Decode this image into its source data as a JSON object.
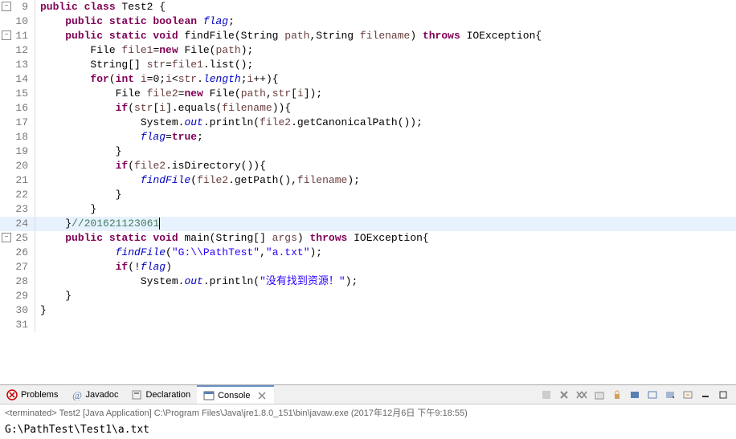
{
  "chart_data": null,
  "editor": {
    "lines": [
      {
        "num": 9,
        "marker": "minus",
        "tokens": [
          {
            "t": "public ",
            "c": "kw"
          },
          {
            "t": "class ",
            "c": "kw"
          },
          {
            "t": "Test2 {",
            "c": ""
          }
        ]
      },
      {
        "num": 10,
        "tokens": [
          {
            "t": "    ",
            "c": ""
          },
          {
            "t": "public static boolean ",
            "c": "kw"
          },
          {
            "t": "flag",
            "c": "static-it"
          },
          {
            "t": ";",
            "c": ""
          }
        ]
      },
      {
        "num": 11,
        "marker": "minus",
        "tokens": [
          {
            "t": "    ",
            "c": ""
          },
          {
            "t": "public static void ",
            "c": "kw"
          },
          {
            "t": "findFile(String ",
            "c": ""
          },
          {
            "t": "path",
            "c": "arg-it"
          },
          {
            "t": ",String ",
            "c": ""
          },
          {
            "t": "filename",
            "c": "arg-it"
          },
          {
            "t": ") ",
            "c": ""
          },
          {
            "t": "throws ",
            "c": "kw"
          },
          {
            "t": "IOException{",
            "c": ""
          }
        ]
      },
      {
        "num": 12,
        "tokens": [
          {
            "t": "        File ",
            "c": ""
          },
          {
            "t": "file1",
            "c": "arg-it"
          },
          {
            "t": "=",
            "c": ""
          },
          {
            "t": "new ",
            "c": "kw"
          },
          {
            "t": "File(",
            "c": ""
          },
          {
            "t": "path",
            "c": "arg-it"
          },
          {
            "t": ");",
            "c": ""
          }
        ]
      },
      {
        "num": 13,
        "tokens": [
          {
            "t": "        String[] ",
            "c": ""
          },
          {
            "t": "str",
            "c": "arg-it"
          },
          {
            "t": "=",
            "c": ""
          },
          {
            "t": "file1",
            "c": "arg-it"
          },
          {
            "t": ".list();",
            "c": ""
          }
        ]
      },
      {
        "num": 14,
        "tokens": [
          {
            "t": "        ",
            "c": ""
          },
          {
            "t": "for",
            "c": "kw"
          },
          {
            "t": "(",
            "c": ""
          },
          {
            "t": "int ",
            "c": "kw"
          },
          {
            "t": "i",
            "c": "arg-it"
          },
          {
            "t": "=0;",
            "c": ""
          },
          {
            "t": "i",
            "c": "arg-it"
          },
          {
            "t": "<",
            "c": ""
          },
          {
            "t": "str",
            "c": "arg-it"
          },
          {
            "t": ".",
            "c": ""
          },
          {
            "t": "length",
            "c": "static-it"
          },
          {
            "t": ";",
            "c": ""
          },
          {
            "t": "i",
            "c": "arg-it"
          },
          {
            "t": "++){",
            "c": ""
          }
        ]
      },
      {
        "num": 15,
        "tokens": [
          {
            "t": "            File ",
            "c": ""
          },
          {
            "t": "file2",
            "c": "arg-it"
          },
          {
            "t": "=",
            "c": ""
          },
          {
            "t": "new ",
            "c": "kw"
          },
          {
            "t": "File(",
            "c": ""
          },
          {
            "t": "path",
            "c": "arg-it"
          },
          {
            "t": ",",
            "c": ""
          },
          {
            "t": "str",
            "c": "arg-it"
          },
          {
            "t": "[",
            "c": ""
          },
          {
            "t": "i",
            "c": "arg-it"
          },
          {
            "t": "]);",
            "c": ""
          }
        ]
      },
      {
        "num": 16,
        "tokens": [
          {
            "t": "            ",
            "c": ""
          },
          {
            "t": "if",
            "c": "kw"
          },
          {
            "t": "(",
            "c": ""
          },
          {
            "t": "str",
            "c": "arg-it"
          },
          {
            "t": "[",
            "c": ""
          },
          {
            "t": "i",
            "c": "arg-it"
          },
          {
            "t": "].equals(",
            "c": ""
          },
          {
            "t": "filename",
            "c": "arg-it"
          },
          {
            "t": ")){",
            "c": ""
          }
        ]
      },
      {
        "num": 17,
        "tokens": [
          {
            "t": "                System.",
            "c": ""
          },
          {
            "t": "out",
            "c": "static-it"
          },
          {
            "t": ".println(",
            "c": ""
          },
          {
            "t": "file2",
            "c": "arg-it"
          },
          {
            "t": ".getCanonicalPath());",
            "c": ""
          }
        ]
      },
      {
        "num": 18,
        "tokens": [
          {
            "t": "                ",
            "c": ""
          },
          {
            "t": "flag",
            "c": "static-it"
          },
          {
            "t": "=",
            "c": ""
          },
          {
            "t": "true",
            "c": "kw"
          },
          {
            "t": ";",
            "c": ""
          }
        ]
      },
      {
        "num": 19,
        "tokens": [
          {
            "t": "            }",
            "c": ""
          }
        ]
      },
      {
        "num": 20,
        "tokens": [
          {
            "t": "            ",
            "c": ""
          },
          {
            "t": "if",
            "c": "kw"
          },
          {
            "t": "(",
            "c": ""
          },
          {
            "t": "file2",
            "c": "arg-it"
          },
          {
            "t": ".isDirectory()){",
            "c": ""
          }
        ]
      },
      {
        "num": 21,
        "tokens": [
          {
            "t": "                ",
            "c": ""
          },
          {
            "t": "findFile",
            "c": "static-it"
          },
          {
            "t": "(",
            "c": ""
          },
          {
            "t": "file2",
            "c": "arg-it"
          },
          {
            "t": ".getPath(),",
            "c": ""
          },
          {
            "t": "filename",
            "c": "arg-it"
          },
          {
            "t": ");",
            "c": ""
          }
        ]
      },
      {
        "num": 22,
        "tokens": [
          {
            "t": "            }",
            "c": ""
          }
        ]
      },
      {
        "num": 23,
        "tokens": [
          {
            "t": "        }",
            "c": ""
          }
        ]
      },
      {
        "num": 24,
        "highlight": true,
        "cursor": true,
        "tokens": [
          {
            "t": "    }",
            "c": ""
          },
          {
            "t": "//201621123061",
            "c": "cmt"
          }
        ]
      },
      {
        "num": 25,
        "marker": "minus",
        "tokens": [
          {
            "t": "    ",
            "c": ""
          },
          {
            "t": "public static void ",
            "c": "kw"
          },
          {
            "t": "main(String[] ",
            "c": ""
          },
          {
            "t": "args",
            "c": "arg-it"
          },
          {
            "t": ") ",
            "c": ""
          },
          {
            "t": "throws ",
            "c": "kw"
          },
          {
            "t": "IOException{",
            "c": ""
          }
        ]
      },
      {
        "num": 26,
        "tokens": [
          {
            "t": "            ",
            "c": ""
          },
          {
            "t": "findFile",
            "c": "static-it"
          },
          {
            "t": "(",
            "c": ""
          },
          {
            "t": "\"G:\\\\PathTest\"",
            "c": "str"
          },
          {
            "t": ",",
            "c": ""
          },
          {
            "t": "\"a.txt\"",
            "c": "str"
          },
          {
            "t": ");",
            "c": ""
          }
        ]
      },
      {
        "num": 27,
        "tokens": [
          {
            "t": "            ",
            "c": ""
          },
          {
            "t": "if",
            "c": "kw"
          },
          {
            "t": "(!",
            "c": ""
          },
          {
            "t": "flag",
            "c": "static-it"
          },
          {
            "t": ")",
            "c": ""
          }
        ]
      },
      {
        "num": 28,
        "tokens": [
          {
            "t": "                System.",
            "c": ""
          },
          {
            "t": "out",
            "c": "static-it"
          },
          {
            "t": ".println(",
            "c": ""
          },
          {
            "t": "\"没有找到资源！\"",
            "c": "str"
          },
          {
            "t": ");",
            "c": ""
          }
        ]
      },
      {
        "num": 29,
        "tokens": [
          {
            "t": "    }",
            "c": ""
          }
        ]
      },
      {
        "num": 30,
        "tokens": [
          {
            "t": "}",
            "c": ""
          }
        ]
      },
      {
        "num": 31,
        "tokens": [
          {
            "t": "",
            "c": ""
          }
        ]
      }
    ]
  },
  "tabs": {
    "problems": "Problems",
    "javadoc": "Javadoc",
    "declaration": "Declaration",
    "console": "Console"
  },
  "status": "<terminated> Test2 [Java Application] C:\\Program Files\\Java\\jre1.8.0_151\\bin\\javaw.exe (2017年12月6日 下午9:18:55)",
  "output": "G:\\PathTest\\Test1\\a.txt"
}
